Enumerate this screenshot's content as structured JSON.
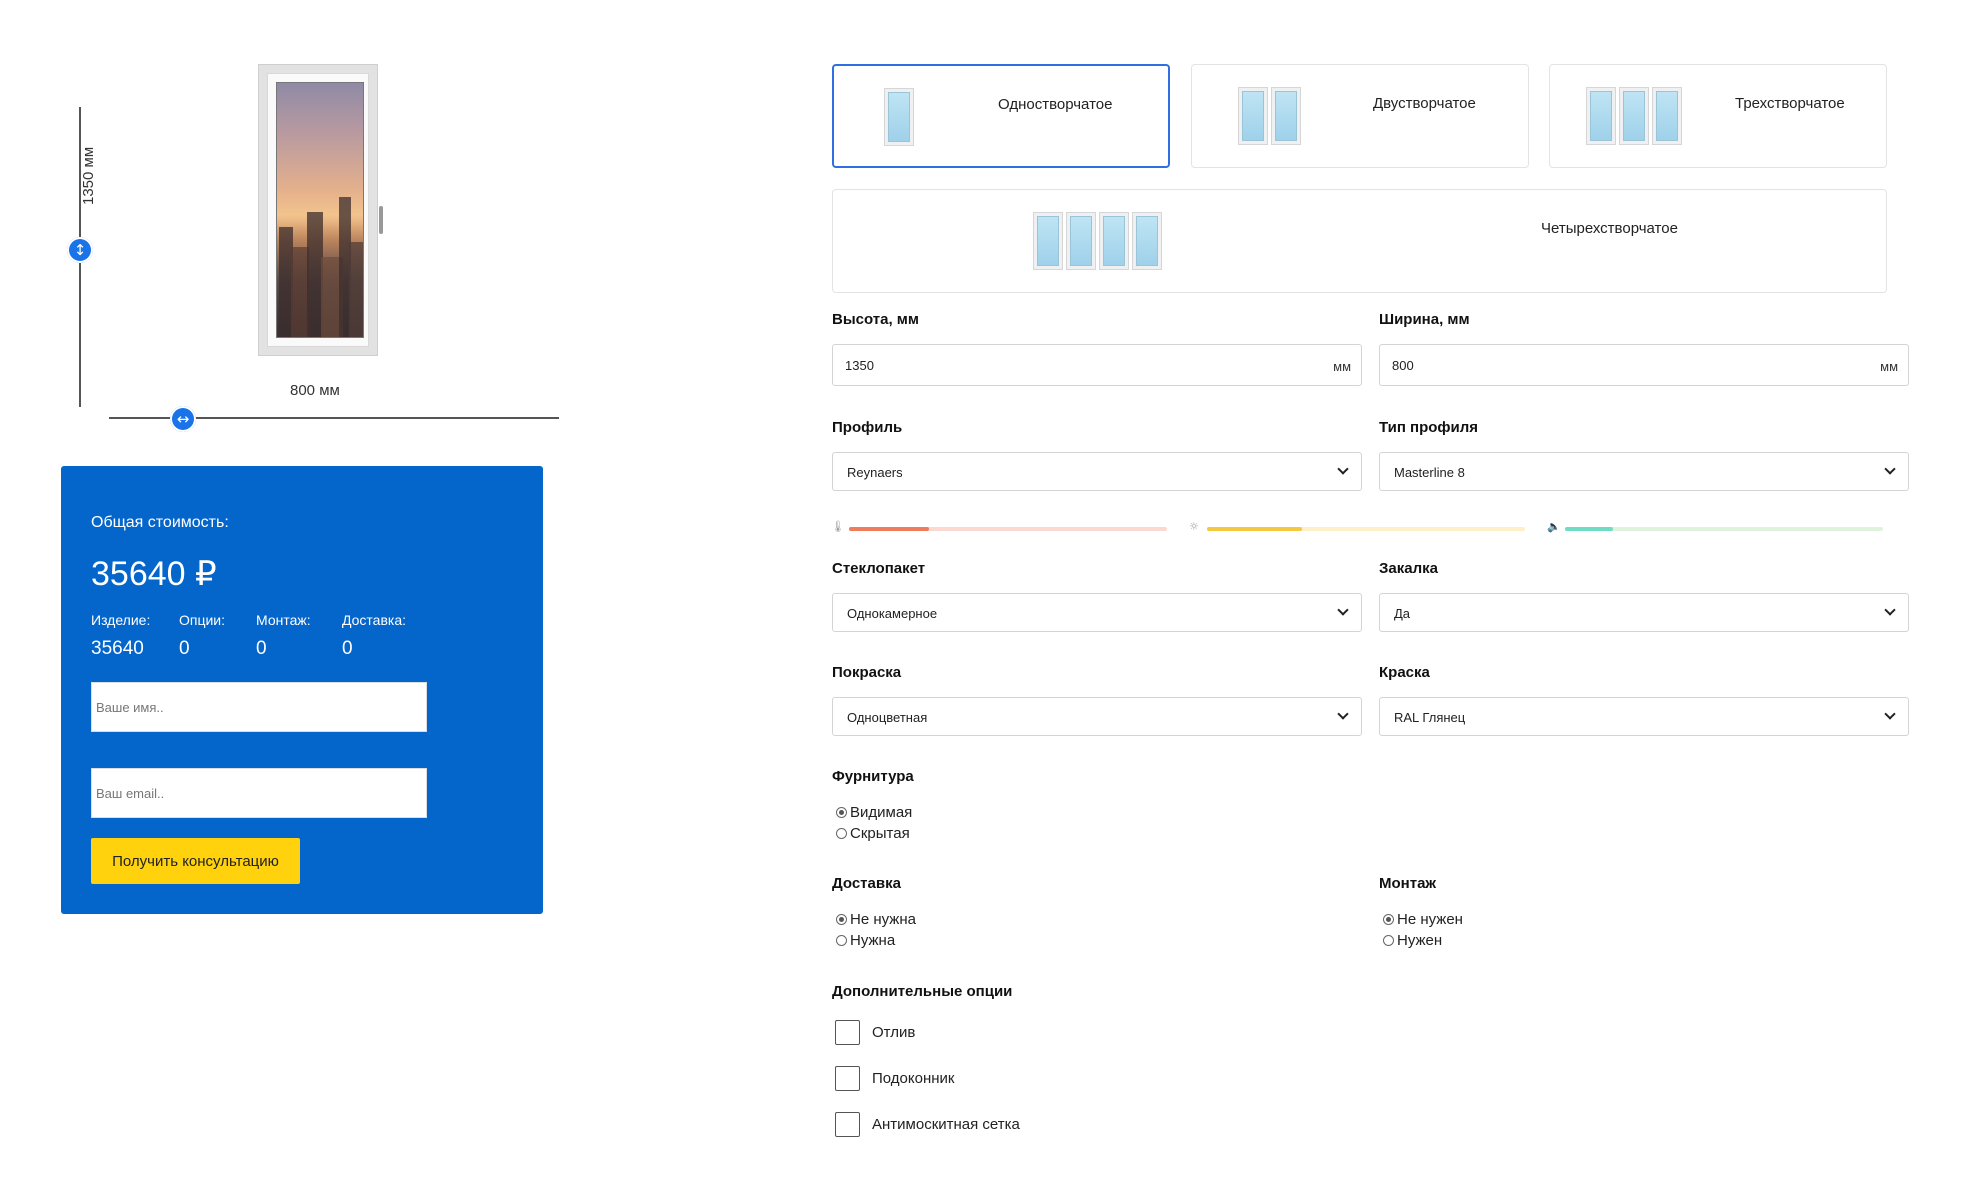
{
  "preview": {
    "height_label": "1350 мм",
    "width_label": "800 мм",
    "height_icon": "vertical-resize-icon",
    "width_icon": "horizontal-resize-icon"
  },
  "cost": {
    "title": "Общая стоимость:",
    "total": "35640 ₽",
    "breakdown": [
      {
        "label": "Изделие:",
        "value": "35640"
      },
      {
        "label": "Опции:",
        "value": "0"
      },
      {
        "label": "Монтаж:",
        "value": "0"
      },
      {
        "label": "Доставка:",
        "value": "0"
      }
    ],
    "name_placeholder": "Ваше имя..",
    "email_placeholder": "Ваш email..",
    "button": "Получить консультацию"
  },
  "window_types": [
    {
      "label": "Одностворчатое",
      "selected": true
    },
    {
      "label": "Двустворчатое",
      "selected": false
    },
    {
      "label": "Трехстворчатое",
      "selected": false
    },
    {
      "label": "Четырехстворчатое",
      "selected": false
    }
  ],
  "dimensions": {
    "height": {
      "label": "Высота, мм",
      "value": "1350",
      "unit": "мм"
    },
    "width": {
      "label": "Ширина, мм",
      "value": "800",
      "unit": "мм"
    }
  },
  "profile": {
    "label": "Профиль",
    "value": "Reynaers"
  },
  "profile_type": {
    "label": "Тип профиля",
    "value": "Masterline 8"
  },
  "ratings": [
    {
      "icon": "thermometer-icon",
      "level": 0.25,
      "color": "#ef7c5c",
      "track_color": "#fbd9d0"
    },
    {
      "icon": "sun-icon",
      "level": 0.3,
      "color": "#f5c842",
      "track_color": "#fdf0c8"
    },
    {
      "icon": "speaker-icon",
      "level": 0.15,
      "color": "#6fdcc4",
      "track_color": "#dff3dc"
    }
  ],
  "glass": {
    "label": "Стеклопакет",
    "value": "Однокамерное"
  },
  "tempering": {
    "label": "Закалка",
    "value": "Да"
  },
  "painting": {
    "label": "Покраска",
    "value": "Одноцветная"
  },
  "paint": {
    "label": "Краска",
    "value": "RAL Глянец"
  },
  "hardware": {
    "label": "Фурнитура",
    "options": [
      {
        "label": "Видимая",
        "checked": true
      },
      {
        "label": "Скрытая",
        "checked": false
      }
    ]
  },
  "delivery": {
    "label": "Доставка",
    "options": [
      {
        "label": "Не нужна",
        "checked": true
      },
      {
        "label": "Нужна",
        "checked": false
      }
    ]
  },
  "installation": {
    "label": "Монтаж",
    "options": [
      {
        "label": "Не нужен",
        "checked": true
      },
      {
        "label": "Нужен",
        "checked": false
      }
    ]
  },
  "extras": {
    "label": "Дополнительные опции",
    "options": [
      {
        "label": "Отлив",
        "checked": false
      },
      {
        "label": "Подоконник",
        "checked": false
      },
      {
        "label": "Антимоскитная сетка",
        "checked": false
      }
    ]
  },
  "colors": {
    "accent": "#0465cb",
    "button": "#ffd20d",
    "selected_border": "#2f6fe0",
    "knob": "#1a73e8"
  }
}
